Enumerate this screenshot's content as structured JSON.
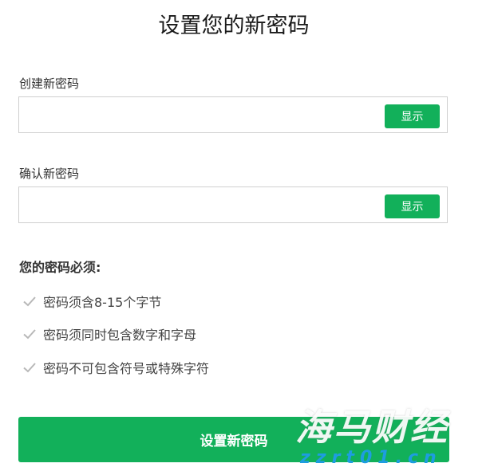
{
  "page": {
    "title": "设置您的新密码"
  },
  "fields": [
    {
      "label": "创建新密码",
      "value": "",
      "placeholder": "",
      "show_label": "显示"
    },
    {
      "label": "确认新密码",
      "value": "",
      "placeholder": "",
      "show_label": "显示"
    }
  ],
  "rules": {
    "heading": "您的密码必须:",
    "items": [
      {
        "text": "密码须含8-15个字节",
        "icon": "check-icon"
      },
      {
        "text": "密码须同时包含数字和字母",
        "icon": "check-icon"
      },
      {
        "text": "密码不可包含符号或特殊字符",
        "icon": "check-icon"
      }
    ]
  },
  "submit": {
    "label": "设置新密码"
  },
  "watermark": {
    "main": "海马财经",
    "sub": "zzrt01.cn"
  },
  "colors": {
    "accent": "#12b05a",
    "check": "#b8b8b8",
    "watermark_sub": "#1e9de0"
  }
}
